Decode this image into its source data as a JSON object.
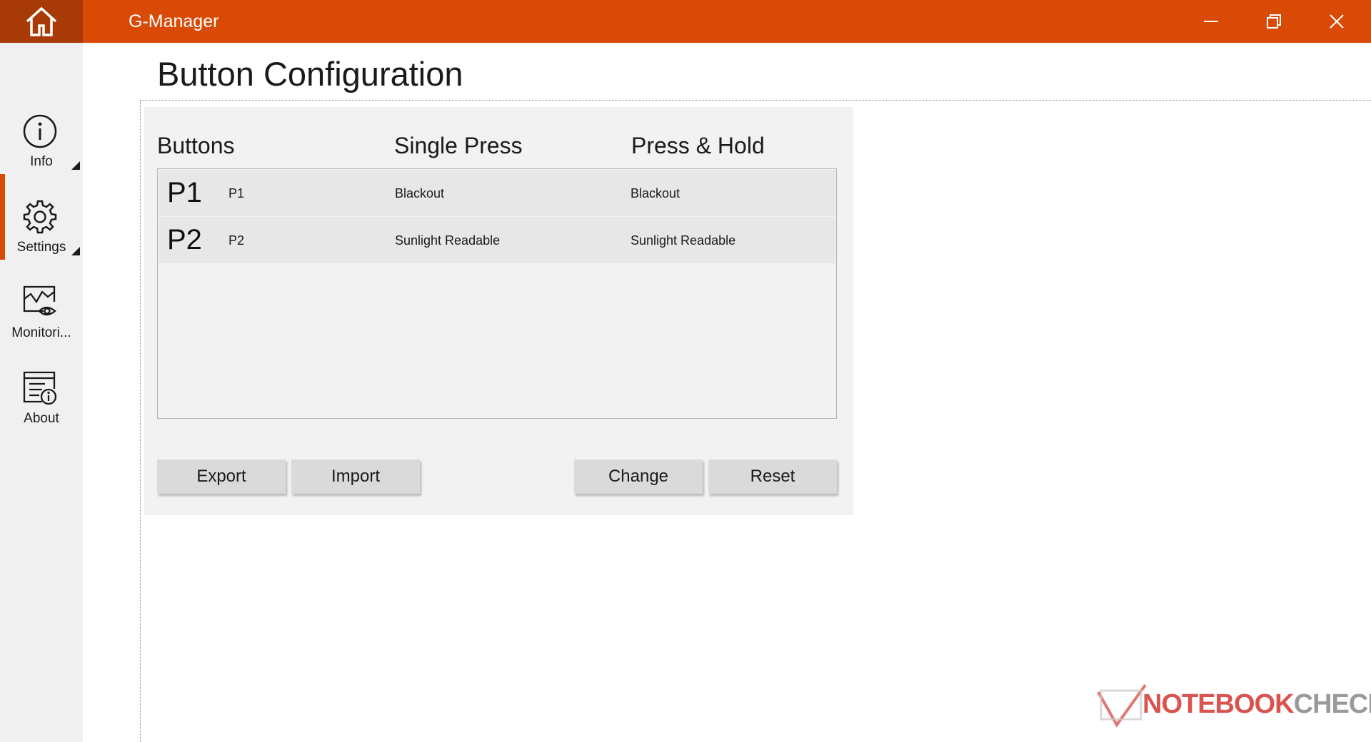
{
  "window": {
    "title": "G-Manager"
  },
  "colors": {
    "accent": "#d94a06",
    "accent_dark": "#a83a08",
    "nav_background": "#f0f0f0",
    "panel_background": "#f2f2f2",
    "row_background": "#e7e7e7",
    "button_background": "#dadada"
  },
  "icons": {
    "home": "home-icon",
    "minimize": "minimize-icon",
    "restore": "restore-icon",
    "close": "close-icon",
    "info": "info-circle-icon",
    "settings": "gear-icon",
    "monitoring": "monitor-eye-icon",
    "about": "document-info-icon"
  },
  "sidebar": {
    "items": [
      {
        "label": "Info",
        "icon": "info-circle-icon",
        "active": false,
        "expandable": true
      },
      {
        "label": "Settings",
        "icon": "gear-icon",
        "active": true,
        "expandable": true
      },
      {
        "label": "Monitori...",
        "icon": "monitor-eye-icon",
        "active": false,
        "expandable": false
      },
      {
        "label": "About",
        "icon": "document-info-icon",
        "active": false,
        "expandable": false
      }
    ]
  },
  "page": {
    "title": "Button Configuration"
  },
  "table": {
    "headers": [
      "Buttons",
      "Single Press",
      "Press & Hold"
    ],
    "rows": [
      {
        "key": "P1",
        "name": "P1",
        "single_press": "Blackout",
        "press_hold": "Blackout"
      },
      {
        "key": "P2",
        "name": "P2",
        "single_press": "Sunlight Readable",
        "press_hold": "Sunlight Readable"
      }
    ]
  },
  "actions": {
    "export_label": "Export",
    "import_label": "Import",
    "change_label": "Change",
    "reset_label": "Reset"
  },
  "watermark": {
    "part1": "NOTEBOOK",
    "part2": "CHECK"
  }
}
